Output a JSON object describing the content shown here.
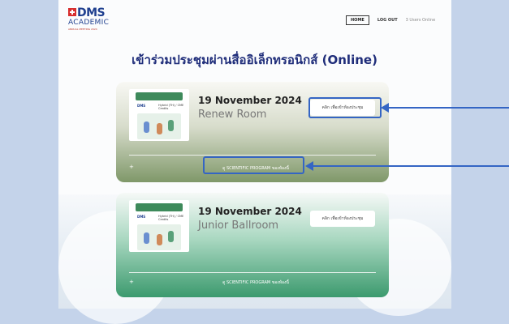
{
  "logo": {
    "mark": "DMS",
    "word": "ACADEMIC",
    "sub": "ANNUAL MEETING 2024"
  },
  "nav": {
    "home": "HOME",
    "logout": "LOG OUT",
    "online": "3 Users Online"
  },
  "title": "เข้าร่วมประชุมผ่านสื่ออิเล็กทรอนิกส์ (Online)",
  "sessions": [
    {
      "date": "19 November 2024",
      "room": "Renew Room",
      "join_label": "คลิก เพื่อเข้าห้องประชุม",
      "program_label": "ดู SCIENTIFIC PROGRAM ของห้องนี้",
      "poster": {
        "ribbon": "Renew Room",
        "mark": "DMS",
        "info": "Hybrid (TH) / CME Credits"
      }
    },
    {
      "date": "19 November 2024",
      "room": "Junior Ballroom",
      "join_label": "คลิก เพื่อเข้าห้องประชุม",
      "program_label": "ดู SCIENTIFIC PROGRAM ของห้องนี้",
      "poster": {
        "ribbon": "Junior Ballroom",
        "mark": "DMS",
        "info": "Hybrid (TH) / CME Credits"
      }
    }
  ],
  "toggle": "+",
  "colors": {
    "accent": "#3465c4",
    "title": "#1f2d7a",
    "card1": "#7f9869",
    "card2": "#3c9a6e"
  }
}
